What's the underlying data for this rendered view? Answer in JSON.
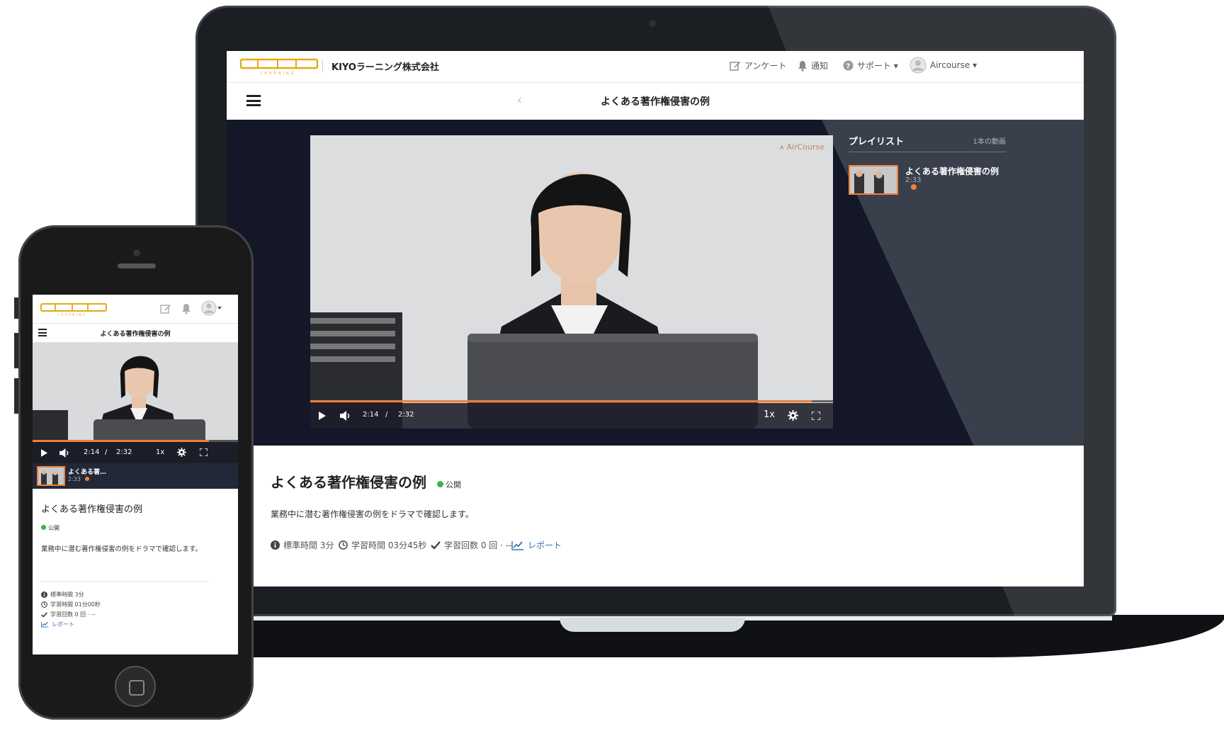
{
  "laptop": {
    "header": {
      "company": "KIYOラーニング株式会社",
      "nav": [
        {
          "icon": "edit-icon",
          "label": "アンケート"
        },
        {
          "icon": "bell-icon",
          "label": "通知"
        },
        {
          "icon": "help-icon",
          "label": "サポート ▾"
        },
        {
          "icon": "user-avatar-icon",
          "label": "Aircourse ▾"
        }
      ]
    },
    "lecture_title": "よくある著作権侵害の例",
    "video": {
      "watermark": "AirCourse",
      "current_time": "2:14",
      "separator": "/",
      "duration": "2:32",
      "speed": "1x",
      "progress": 0.96
    },
    "playlist": {
      "title": "プレイリスト",
      "count": "1本の動画",
      "items": [
        {
          "name": "よくある著作権侵害の例",
          "duration": "2:33"
        }
      ]
    },
    "content": {
      "title": "よくある著作権侵害の例",
      "status": "公開",
      "description": "業務中に潜む著作権侵害の例をドラマで確認します。",
      "meta": {
        "standard_time": "標準時間 3分",
        "study_time": "学習時間 03分45秒",
        "study_count": "学習回数 0 回 · --",
        "report": "レポート"
      }
    }
  },
  "phone": {
    "lecture_title": "よくある著作権侵害の例",
    "video": {
      "current_time": "2:14",
      "separator": "/",
      "duration": "2:32",
      "speed": "1x",
      "progress": 0.86
    },
    "playlist_item": {
      "name": "よくある著…",
      "duration": "2:33"
    },
    "content": {
      "title": "よくある著作権侵害の例",
      "status": "公開",
      "description": "業務中に潜む著作権侵害の例をドラマで確認します。",
      "meta": {
        "standard_time": "標準時間 3分",
        "study_time": "学習時間 01分00秒",
        "study_count": "学習回数 0 回 · --",
        "report": "レポート"
      }
    }
  },
  "colors": {
    "accent": "#f0803a",
    "player_bg": "#131728",
    "status_green": "#3bb34a",
    "link": "#3b6fb3"
  }
}
